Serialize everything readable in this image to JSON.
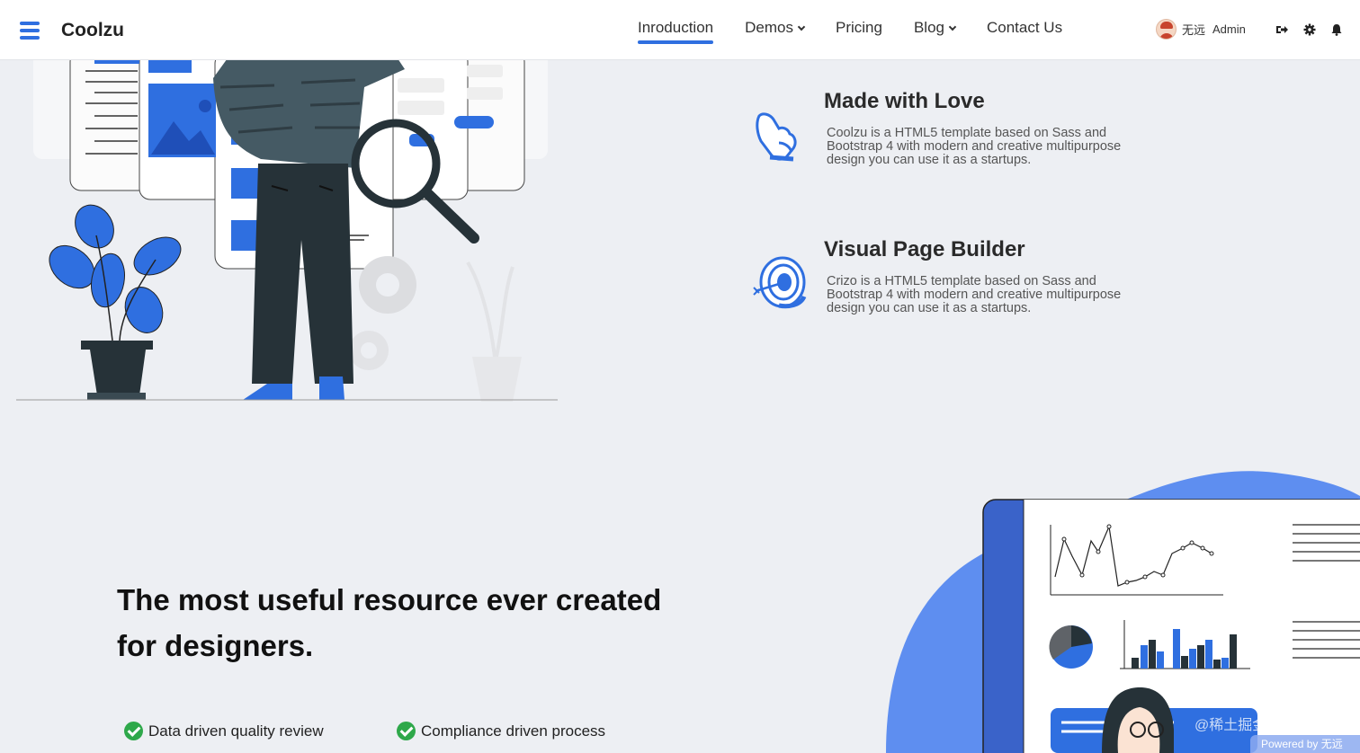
{
  "header": {
    "brand": "Coolzu",
    "nav": [
      {
        "label": "Inroduction",
        "active": true,
        "dropdown": false
      },
      {
        "label": "Demos",
        "active": false,
        "dropdown": true
      },
      {
        "label": "Pricing",
        "active": false,
        "dropdown": false
      },
      {
        "label": "Blog",
        "active": false,
        "dropdown": true
      },
      {
        "label": "Contact Us",
        "active": false,
        "dropdown": false
      }
    ],
    "user": {
      "name": "无远",
      "role": "Admin"
    },
    "icons": [
      "sign-out-icon",
      "gear-icon",
      "bell-icon"
    ]
  },
  "features": [
    {
      "title": "Made with Love",
      "text": "Coolzu is a HTML5 template based on Sass and Bootstrap 4 with modern and creative multipurpose design you can use it as a startups.",
      "icon": "thumbs-up-icon"
    },
    {
      "title": "Visual Page Builder",
      "text": "Crizo is a HTML5 template based on Sass and Bootstrap 4 with modern and creative multipurpose design you can use it as a startups.",
      "icon": "target-icon"
    }
  ],
  "hero": {
    "headline": "The most useful resource ever created for designers.",
    "checks": [
      "Data driven quality review",
      "Compliance driven process"
    ]
  },
  "footer_overlay": {
    "watermark": "@稀土掘金技术社区",
    "powered": "Powered by 无远"
  },
  "colors": {
    "accent": "#2f6fe0",
    "check": "#2ea84a",
    "dark": "#263238"
  }
}
